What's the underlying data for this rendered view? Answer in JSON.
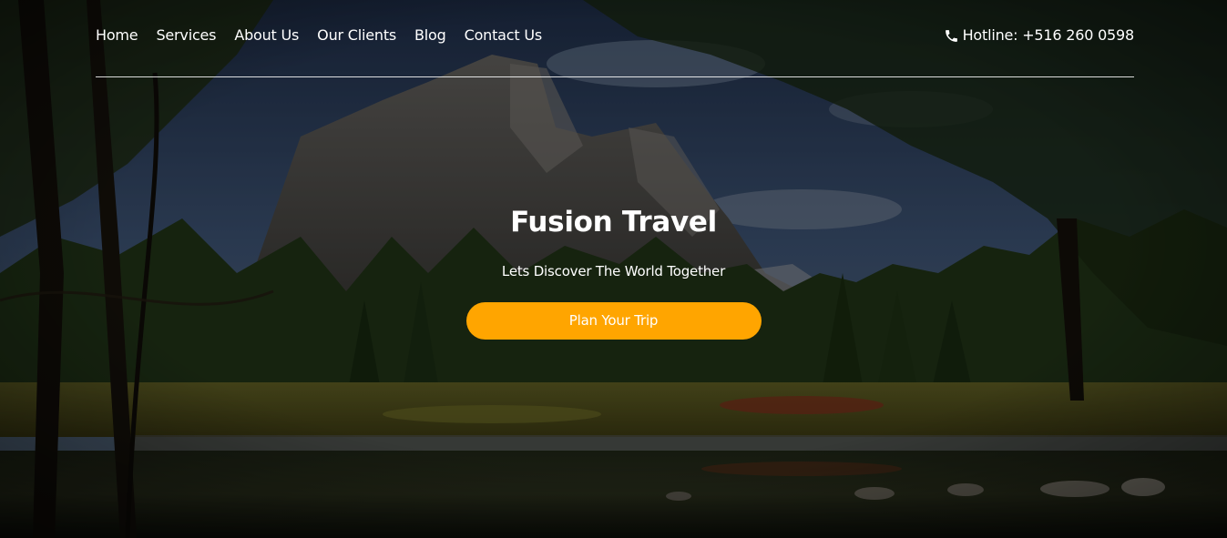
{
  "nav": {
    "items": [
      {
        "label": "Home"
      },
      {
        "label": "Services"
      },
      {
        "label": "About Us"
      },
      {
        "label": "Our Clients"
      },
      {
        "label": "Blog"
      },
      {
        "label": "Contact Us"
      }
    ],
    "hotline": "Hotline: +516 260 0598"
  },
  "hero": {
    "title": "Fusion Travel",
    "subtitle": "Lets Discover The World Together",
    "cta_label": "Plan Your Trip"
  },
  "colors": {
    "accent": "#ffa500",
    "text": "#ffffff"
  },
  "icons": {
    "phone": "phone-icon"
  }
}
